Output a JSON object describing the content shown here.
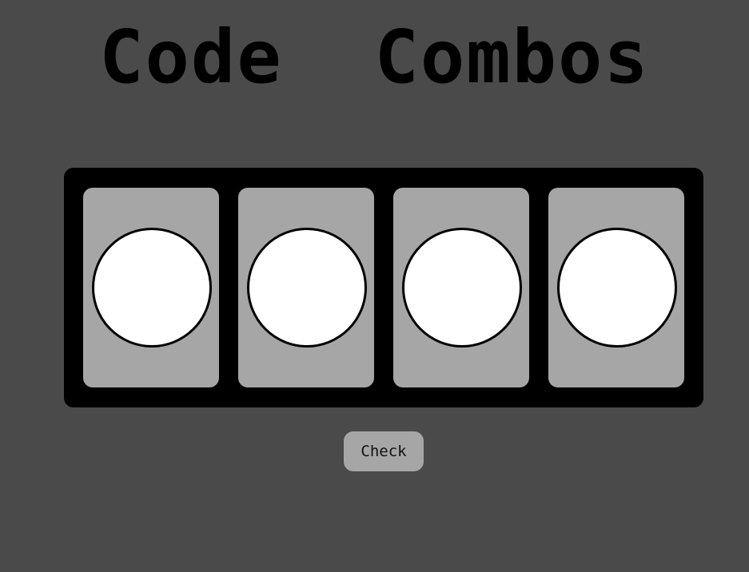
{
  "title": "Code  Combos",
  "slots": [
    {
      "peg_color": "#ffffff"
    },
    {
      "peg_color": "#ffffff"
    },
    {
      "peg_color": "#ffffff"
    },
    {
      "peg_color": "#ffffff"
    }
  ],
  "check_button": {
    "label": "Check"
  },
  "colors": {
    "background": "#4a4a4a",
    "board": "#000000",
    "slot": "#a6a6a6",
    "peg_border": "#000000"
  }
}
